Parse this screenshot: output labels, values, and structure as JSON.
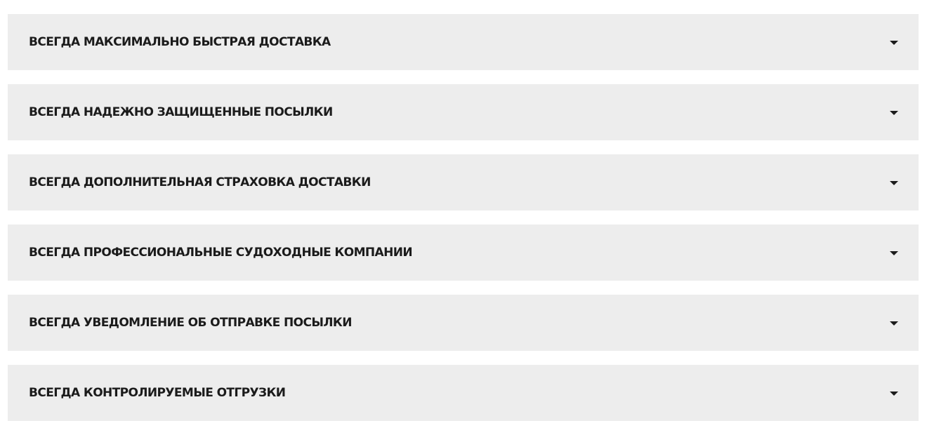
{
  "accordion": {
    "items": [
      {
        "title": "ВСЕГДА МАКСИМАЛЬНО БЫСТРАЯ ДОСТАВКА",
        "icon": "caret-down-icon"
      },
      {
        "title": "ВСЕГДА НАДЕЖНО ЗАЩИЩЕННЫЕ ПОСЫЛКИ",
        "icon": "caret-down-icon"
      },
      {
        "title": "ВСЕГДА ДОПОЛНИТЕЛЬНАЯ СТРАХОВКА ДОСТАВКИ",
        "icon": "caret-down-icon"
      },
      {
        "title": "ВСЕГДА ПРОФЕССИОНАЛЬНЫЕ СУДОХОДНЫЕ КОМПАНИИ",
        "icon": "caret-down-icon"
      },
      {
        "title": "ВСЕГДА УВЕДОМЛЕНИЕ ОБ ОТПРАВКЕ ПОСЫЛКИ",
        "icon": "caret-down-icon"
      },
      {
        "title": "ВСЕГДА КОНТРОЛИРУЕМЫЕ ОТГРУЗКИ",
        "icon": "caret-down-icon"
      }
    ]
  },
  "colors": {
    "item_background": "#ededed",
    "text": "#1b1b1b",
    "page_background": "#ffffff"
  }
}
